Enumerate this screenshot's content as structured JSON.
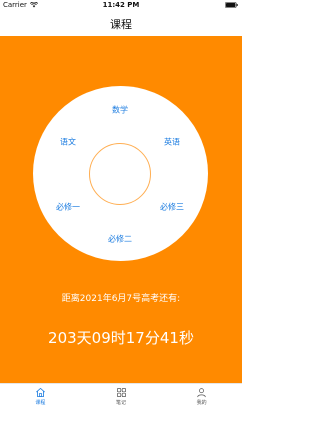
{
  "status_bar": {
    "carrier": "Carrier",
    "time": "11:42 PM"
  },
  "nav": {
    "title": "课程"
  },
  "subjects": {
    "math": "数学",
    "chinese": "语文",
    "english": "英语",
    "compulsory_1": "必修一",
    "compulsory_2": "必修二",
    "compulsory_3": "必修三"
  },
  "countdown": {
    "label": "距离2021年6月7号高考还有:",
    "value": "203天09时17分41秒"
  },
  "tabs": [
    {
      "label": "课程",
      "icon": "home-icon",
      "active": true
    },
    {
      "label": "笔记",
      "icon": "grid-icon",
      "active": false
    },
    {
      "label": "我的",
      "icon": "person-icon",
      "active": false
    }
  ],
  "colors": {
    "accent": "#ff8a00",
    "subject_text": "#1a7be0",
    "active_tab": "#1a7be0"
  }
}
